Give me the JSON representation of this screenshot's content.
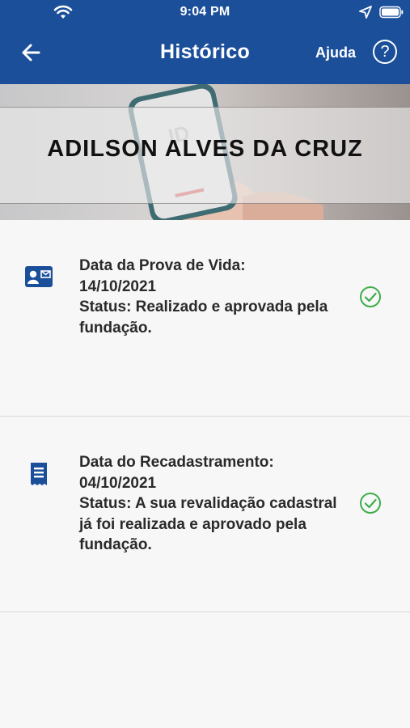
{
  "status_bar": {
    "time": "9:04 PM"
  },
  "navbar": {
    "title": "Histórico",
    "help_label": "Ajuda",
    "help_symbol": "?"
  },
  "banner": {
    "name": "ADILSON ALVES DA CRUZ"
  },
  "records": [
    {
      "icon": "id-card-icon",
      "title": "Data da Prova de Vida:",
      "date": "14/10/2021",
      "status": "Status: Realizado e aprovada pela fundação.",
      "status_icon": "check-circle-icon"
    },
    {
      "icon": "document-icon",
      "title": "Data do Recadastramento:",
      "date": "04/10/2021",
      "status": "Status: A sua revalidação cadastral já foi realizada e aprovado pela fundação.",
      "status_icon": "check-circle-icon"
    }
  ],
  "colors": {
    "header": "#1b4f9a",
    "icon": "#1b4f9a",
    "check": "#3dad4b",
    "background": "#f7f7f7"
  }
}
